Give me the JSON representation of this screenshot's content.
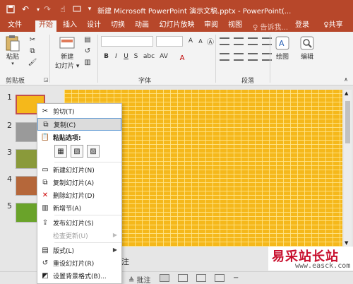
{
  "titlebar": {
    "title": "新建 Microsoft PowerPoint 演示文稿.pptx - PowerPoint(...",
    "icons": [
      "save-icon",
      "undo-icon",
      "redo-icon",
      "touch-mode-icon",
      "qat-dropdown-icon"
    ],
    "bg_color": "#b7472a"
  },
  "menubar": {
    "items": [
      "文件",
      "开始",
      "插入",
      "设计",
      "切换",
      "动画",
      "幻灯片放映",
      "审阅",
      "视图"
    ],
    "active": "开始",
    "tell_me": "♀ 告诉我...",
    "login": "登录",
    "share": "♀共享"
  },
  "ribbon": {
    "paste": "粘贴",
    "new_slide": "新建",
    "slide_dropdown": "幻灯片 ▾",
    "drawing": "绘图",
    "edit": "编辑",
    "groups": {
      "clipboard": "剪贴板",
      "font": "字体",
      "paragraph": "段落"
    },
    "format_buttons": [
      "B",
      "I",
      "U",
      "S",
      "abc",
      "AV"
    ]
  },
  "slides": {
    "numbers": [
      "1",
      "2",
      "3",
      "4",
      "5"
    ]
  },
  "context_menu": {
    "cut": "剪切(T)",
    "copy": "复制(C)",
    "paste_options": "粘贴选项:",
    "new_slide": "新建幻灯片(N)",
    "duplicate": "复制幻灯片(A)",
    "delete": "删除幻灯片(D)",
    "new_section": "新增节(A)",
    "publish": "发布幻灯片(S)",
    "check_updates": "检查更新(U)",
    "layout": "版式(L)",
    "reset": "重设幻灯片(R)",
    "background": "设置背景格式(B)..."
  },
  "notes": {
    "label": "注"
  },
  "status": {
    "notes_btn": "≜ 批注"
  },
  "watermark": {
    "title": "易采站长站",
    "url": "www.easck.com"
  },
  "colors": {
    "accent": "#b7472a",
    "slide_bg": "#f5b81b",
    "highlight_border": "#6aa0d6"
  }
}
